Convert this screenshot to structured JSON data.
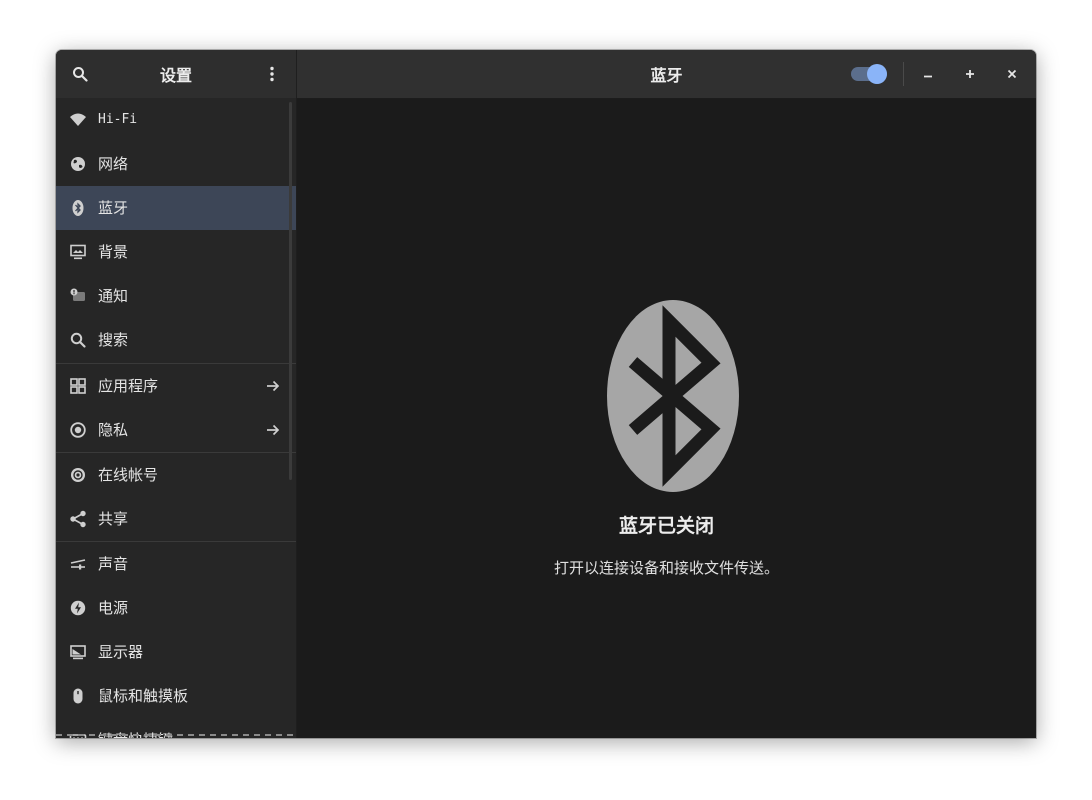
{
  "sidebar_header": {
    "title": "设置",
    "search_icon": "search-icon",
    "menu_icon": "vertical-dots-menu-icon"
  },
  "content_header": {
    "title": "蓝牙",
    "bluetooth_toggle_on": true
  },
  "window_controls": {
    "minimize": "–",
    "maximize": "+",
    "close": "×"
  },
  "sidebar": {
    "items": [
      {
        "label": "Hi-Fi",
        "icon": "wifi-icon"
      },
      {
        "label": "网络",
        "icon": "network-globe-icon"
      },
      {
        "label": "蓝牙",
        "icon": "bluetooth-icon",
        "selected": true
      },
      {
        "label": "背景",
        "icon": "background-monitor-icon"
      },
      {
        "label": "通知",
        "icon": "notification-icon"
      },
      {
        "label": "搜索",
        "icon": "search-icon"
      },
      {
        "label": "应用程序",
        "icon": "applications-grid-icon",
        "has_arrow": true
      },
      {
        "label": "隐私",
        "icon": "privacy-icon",
        "has_arrow": true
      },
      {
        "label": "在线帐号",
        "icon": "online-accounts-icon"
      },
      {
        "label": "共享",
        "icon": "share-icon"
      },
      {
        "label": "声音",
        "icon": "sound-icon"
      },
      {
        "label": "电源",
        "icon": "power-icon"
      },
      {
        "label": "显示器",
        "icon": "display-icon"
      },
      {
        "label": "鼠标和触摸板",
        "icon": "mouse-icon"
      },
      {
        "label": "键盘快捷键",
        "icon": "keyboard-icon"
      }
    ]
  },
  "main": {
    "status_icon": "bluetooth-disabled-icon",
    "status_title": "蓝牙已关闭",
    "status_description": "打开以连接设备和接收文件传送。"
  },
  "colors": {
    "selected_row": "#3d4657",
    "toggle_track": "#5b6e8c",
    "toggle_knob": "#8ab4f8",
    "content_bg": "#1b1b1b",
    "sidebar_bg": "#262626",
    "status_icon_fill": "#a6a6a6"
  }
}
